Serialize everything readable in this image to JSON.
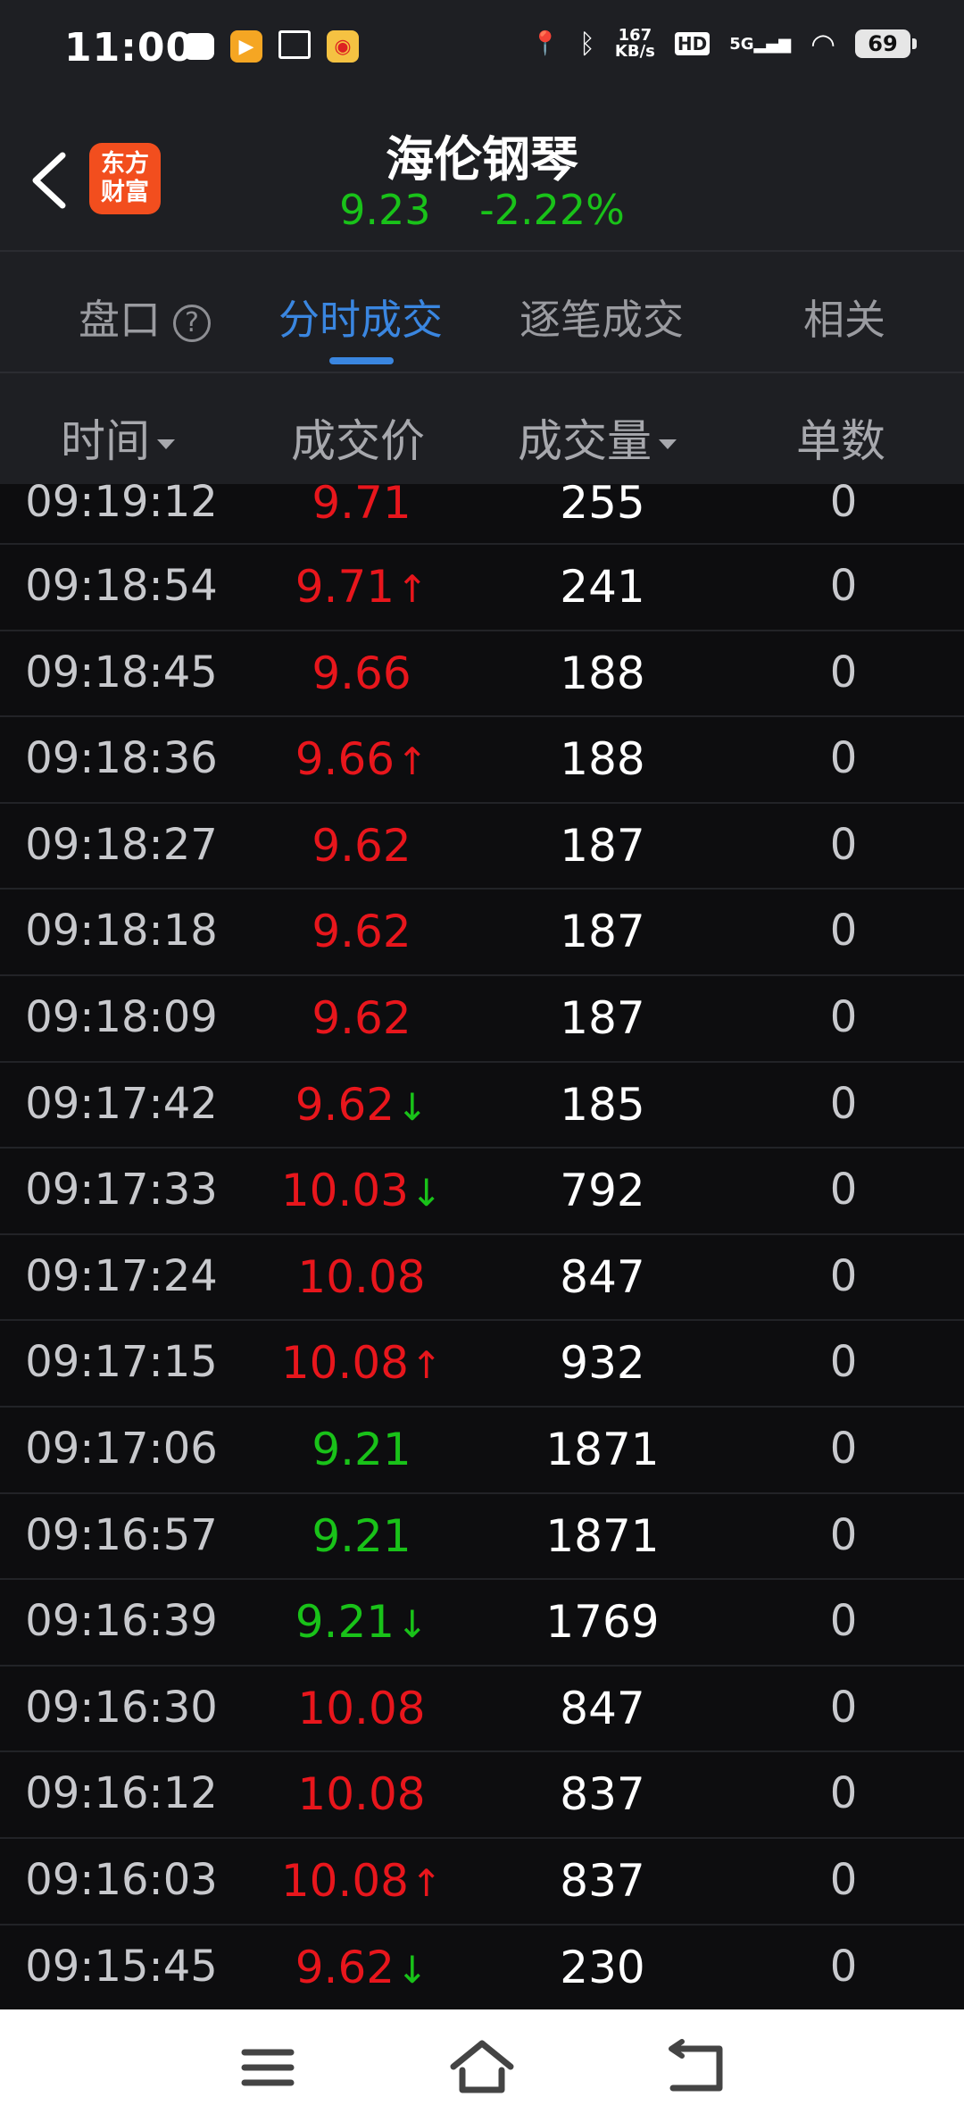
{
  "status_bar": {
    "time": "11:00",
    "net_speed": "167\nKB/s",
    "network": "5G",
    "hd": "HD",
    "battery": "69"
  },
  "header": {
    "logo_line1": "东方",
    "logo_line2": "财富",
    "stock_name": "海伦钢琴",
    "price": "9.23",
    "change_pct": "-2.22%"
  },
  "tabs": [
    {
      "label": "盘口"
    },
    {
      "label": "分时成交"
    },
    {
      "label": "逐笔成交"
    },
    {
      "label": "相关"
    }
  ],
  "columns": {
    "time": "时间",
    "price": "成交价",
    "volume": "成交量",
    "count": "单数"
  },
  "trades": [
    {
      "time": "09:19:12",
      "price": "9.71",
      "color": "red",
      "dir": "",
      "volume": "255",
      "count": "0"
    },
    {
      "time": "09:18:54",
      "price": "9.71",
      "color": "red",
      "dir": "↑",
      "volume": "241",
      "count": "0"
    },
    {
      "time": "09:18:45",
      "price": "9.66",
      "color": "red",
      "dir": "",
      "volume": "188",
      "count": "0"
    },
    {
      "time": "09:18:36",
      "price": "9.66",
      "color": "red",
      "dir": "↑",
      "volume": "188",
      "count": "0"
    },
    {
      "time": "09:18:27",
      "price": "9.62",
      "color": "red",
      "dir": "",
      "volume": "187",
      "count": "0"
    },
    {
      "time": "09:18:18",
      "price": "9.62",
      "color": "red",
      "dir": "",
      "volume": "187",
      "count": "0"
    },
    {
      "time": "09:18:09",
      "price": "9.62",
      "color": "red",
      "dir": "",
      "volume": "187",
      "count": "0"
    },
    {
      "time": "09:17:42",
      "price": "9.62",
      "color": "red",
      "dir": "↓",
      "volume": "185",
      "count": "0"
    },
    {
      "time": "09:17:33",
      "price": "10.03",
      "color": "red",
      "dir": "↓",
      "volume": "792",
      "count": "0"
    },
    {
      "time": "09:17:24",
      "price": "10.08",
      "color": "red",
      "dir": "",
      "volume": "847",
      "count": "0"
    },
    {
      "time": "09:17:15",
      "price": "10.08",
      "color": "red",
      "dir": "↑",
      "volume": "932",
      "count": "0"
    },
    {
      "time": "09:17:06",
      "price": "9.21",
      "color": "green",
      "dir": "",
      "volume": "1871",
      "count": "0"
    },
    {
      "time": "09:16:57",
      "price": "9.21",
      "color": "green",
      "dir": "",
      "volume": "1871",
      "count": "0"
    },
    {
      "time": "09:16:39",
      "price": "9.21",
      "color": "green",
      "dir": "↓",
      "volume": "1769",
      "count": "0"
    },
    {
      "time": "09:16:30",
      "price": "10.08",
      "color": "red",
      "dir": "",
      "volume": "847",
      "count": "0"
    },
    {
      "time": "09:16:12",
      "price": "10.08",
      "color": "red",
      "dir": "",
      "volume": "837",
      "count": "0"
    },
    {
      "time": "09:16:03",
      "price": "10.08",
      "color": "red",
      "dir": "↑",
      "volume": "837",
      "count": "0"
    },
    {
      "time": "09:15:45",
      "price": "9.62",
      "color": "red",
      "dir": "↓",
      "volume": "230",
      "count": "0"
    }
  ],
  "colors": {
    "up": "#e8161c",
    "down": "#19c219",
    "accent": "#3a86e0"
  }
}
